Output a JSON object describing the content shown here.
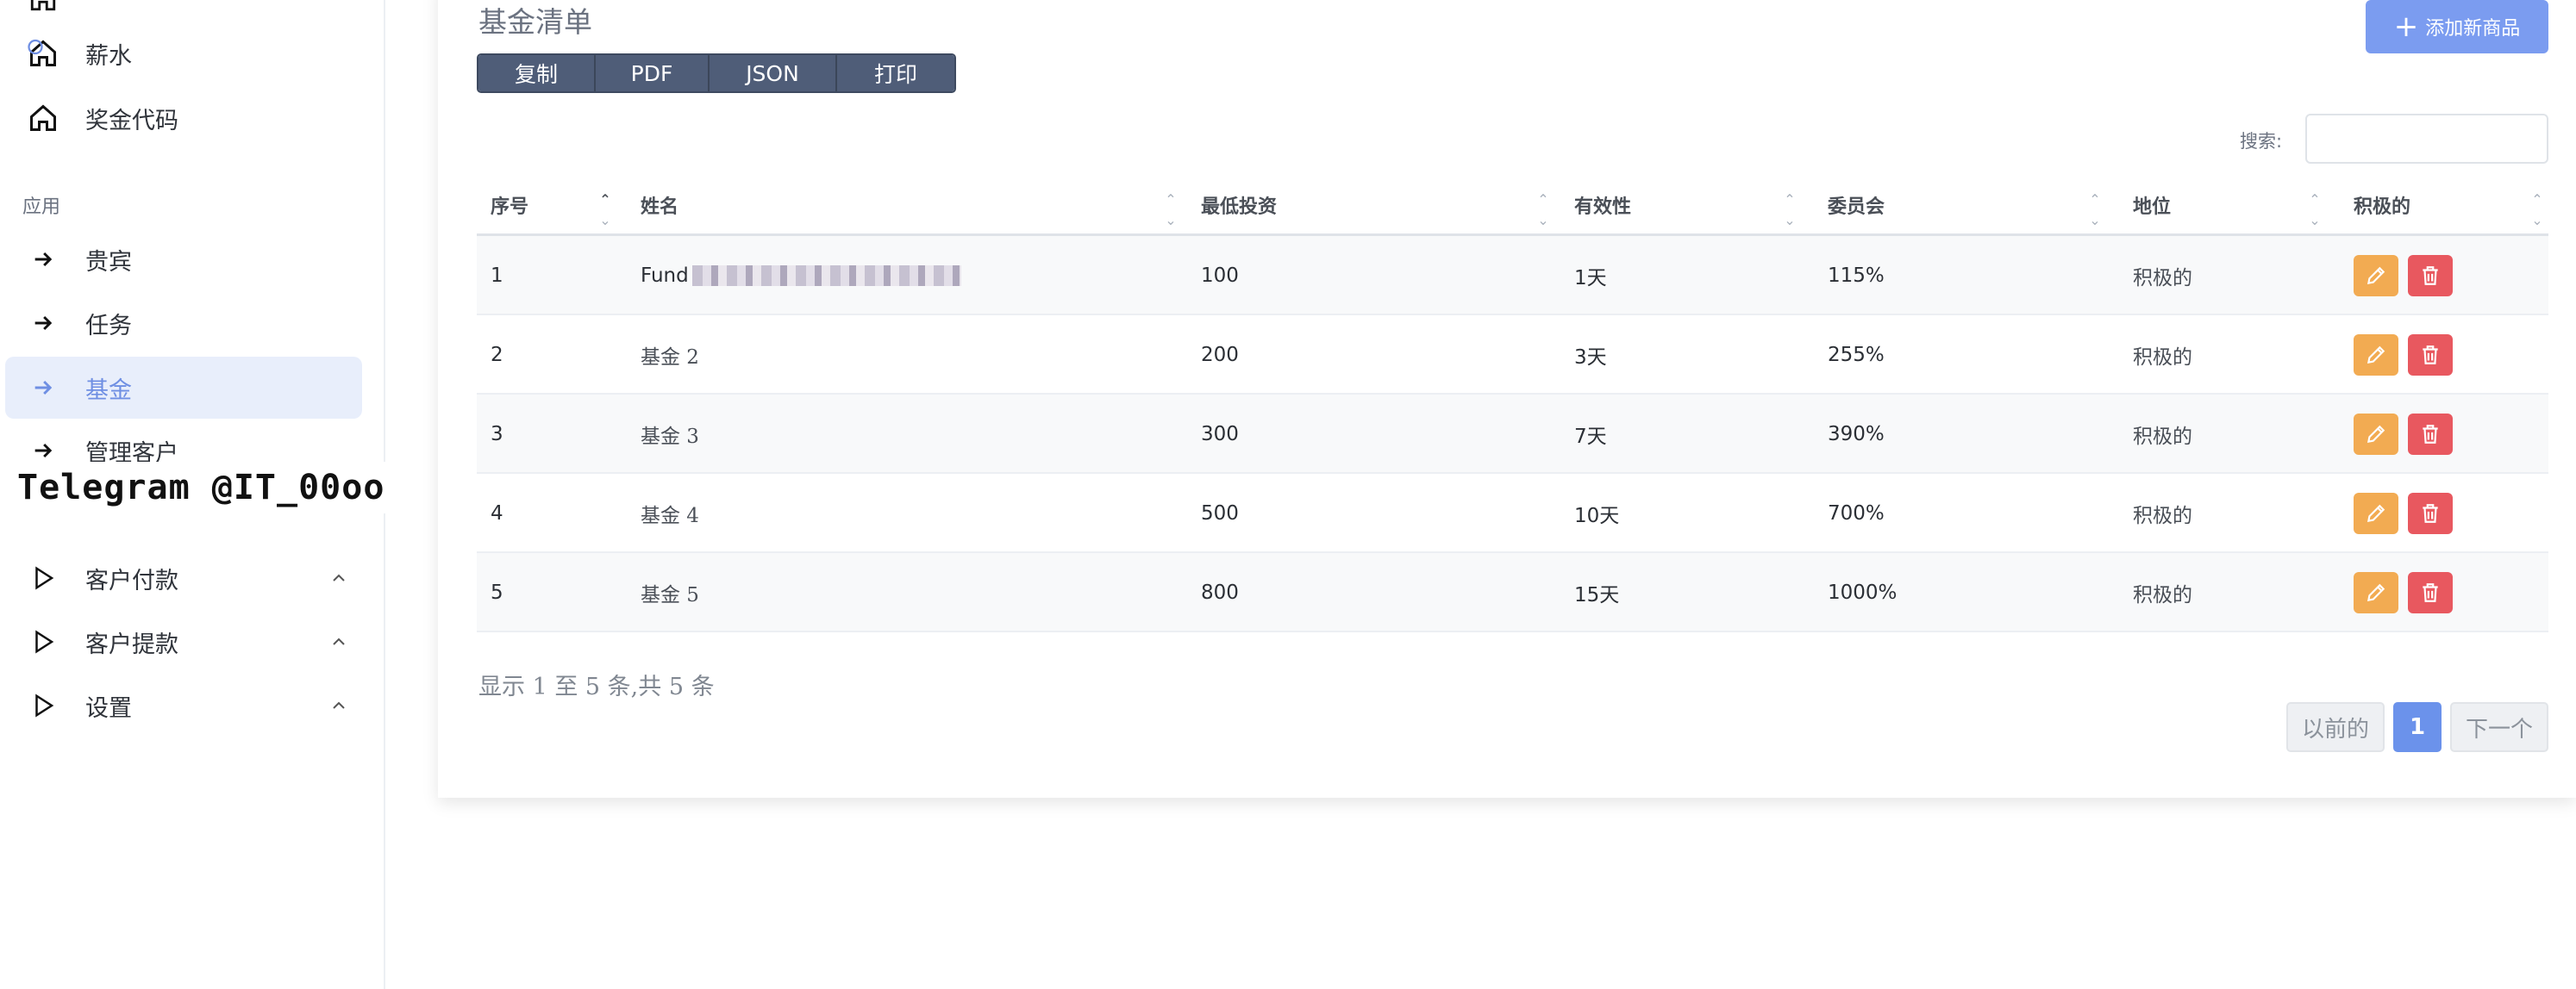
{
  "sidebar": {
    "items": [
      {
        "label": "薪水",
        "icon": "home-icon"
      },
      {
        "label": "奖金代码",
        "icon": "home-icon"
      }
    ],
    "section_label": "应用",
    "app_items": [
      {
        "label": "贵宾",
        "icon": "arrow-right-icon"
      },
      {
        "label": "任务",
        "icon": "arrow-right-icon"
      },
      {
        "label": "基金",
        "icon": "arrow-right-icon",
        "active": true
      },
      {
        "label": "管理客户",
        "icon": "arrow-right-icon"
      }
    ],
    "watermark": "Telegram @IT_00oo",
    "group_items": [
      {
        "label": "客户付款",
        "icon": "play-icon"
      },
      {
        "label": "客户提款",
        "icon": "play-icon"
      },
      {
        "label": "设置",
        "icon": "play-icon"
      }
    ]
  },
  "card": {
    "title": "基金清单",
    "add_button": "添加新商品",
    "export_buttons": [
      "复制",
      "PDF",
      "JSON",
      "打印"
    ],
    "search_label": "搜索:",
    "search_value": ""
  },
  "table": {
    "columns": [
      "序号",
      "姓名",
      "最低投资",
      "有效性",
      "委员会",
      "地位",
      "积极的"
    ],
    "rows": [
      {
        "id": "1",
        "name": "Fund",
        "min": "100",
        "validity": "1天",
        "commission": "115%",
        "status": "积极的"
      },
      {
        "id": "2",
        "name": "基金 2",
        "min": "200",
        "validity": "3天",
        "commission": "255%",
        "status": "积极的"
      },
      {
        "id": "3",
        "name": "基金 3",
        "min": "300",
        "validity": "7天",
        "commission": "390%",
        "status": "积极的"
      },
      {
        "id": "4",
        "name": "基金 4",
        "min": "500",
        "validity": "10天",
        "commission": "700%",
        "status": "积极的"
      },
      {
        "id": "5",
        "name": "基金 5",
        "min": "800",
        "validity": "15天",
        "commission": "1000%",
        "status": "积极的"
      }
    ]
  },
  "footer": {
    "info": "显示 1 至 5 条,共 5 条",
    "prev": "以前的",
    "current": "1",
    "next": "下一个"
  }
}
